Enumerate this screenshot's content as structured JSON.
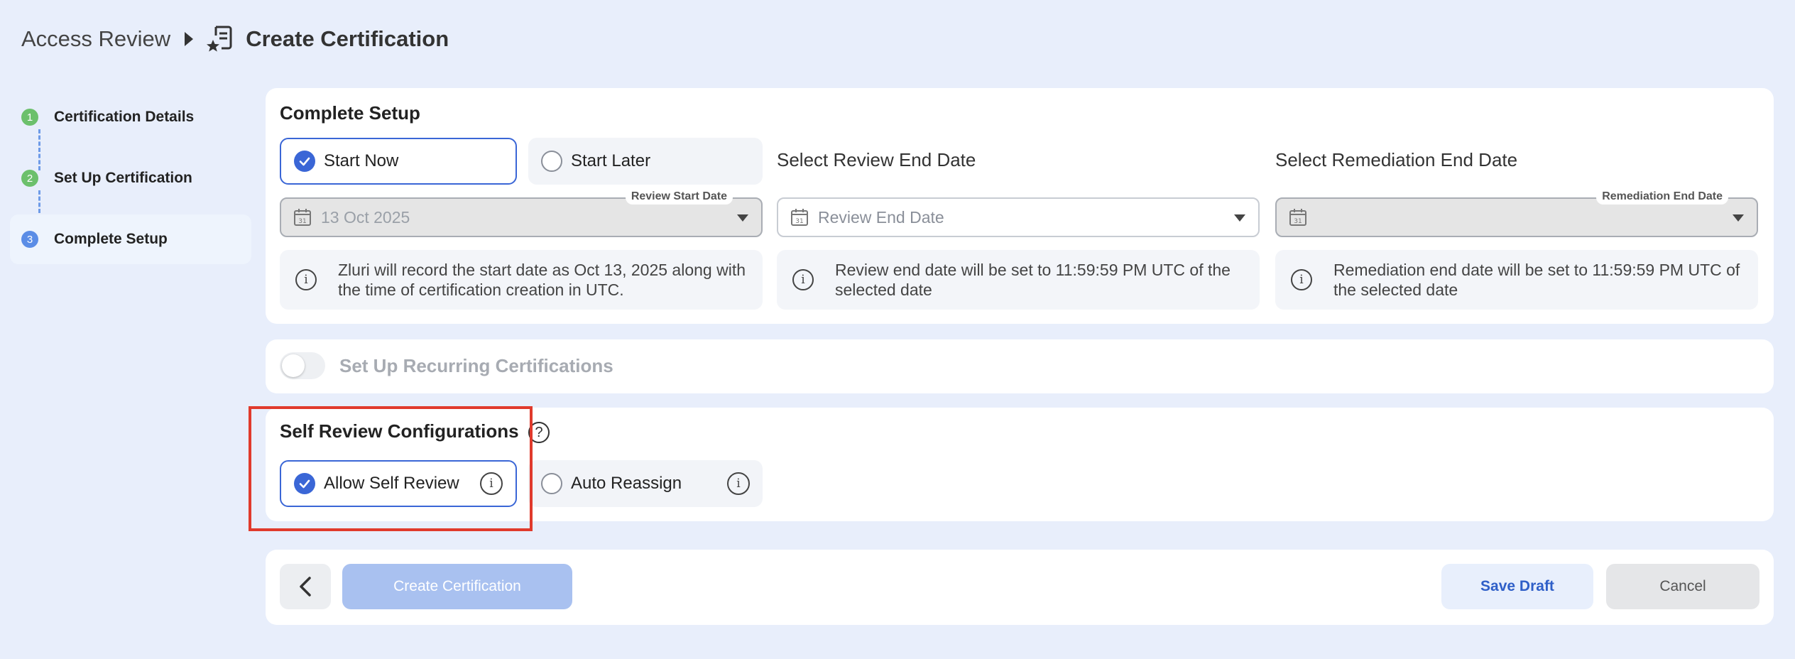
{
  "breadcrumb": {
    "root": "Access Review",
    "current": "Create Certification"
  },
  "stepper": {
    "steps": [
      {
        "num": "1",
        "label": "Certification Details",
        "state": "done"
      },
      {
        "num": "2",
        "label": "Set Up Certification",
        "state": "done"
      },
      {
        "num": "3",
        "label": "Complete Setup",
        "state": "current"
      }
    ]
  },
  "setup": {
    "title": "Complete Setup",
    "start_now": "Start Now",
    "start_later": "Start Later",
    "review_start": {
      "float_label": "Review Start Date",
      "value": "13 Oct 2025",
      "info": "Zluri will record the start date as Oct 13, 2025 along with the time of certification creation in UTC."
    },
    "review_end": {
      "title": "Select Review End Date",
      "placeholder": "Review End Date",
      "info": "Review end date will be set to 11:59:59 PM UTC of the selected date"
    },
    "remediation_end": {
      "title": "Select Remediation End Date",
      "float_label": "Remediation End Date",
      "value": "",
      "info": "Remediation end date will be set to 11:59:59 PM UTC of the selected date"
    },
    "calendar_day": "31"
  },
  "recurring": {
    "label": "Set Up Recurring Certifications",
    "enabled": false
  },
  "self_review": {
    "title": "Self Review Configurations",
    "allow_self_review": "Allow Self Review",
    "auto_reassign": "Auto Reassign"
  },
  "actions": {
    "create": "Create Certification",
    "save_draft": "Save Draft",
    "cancel": "Cancel"
  },
  "colors": {
    "accent": "#3a66d6",
    "highlight": "#e03a2c",
    "step_done": "#6cc06c",
    "step_current": "#5b8de6"
  }
}
